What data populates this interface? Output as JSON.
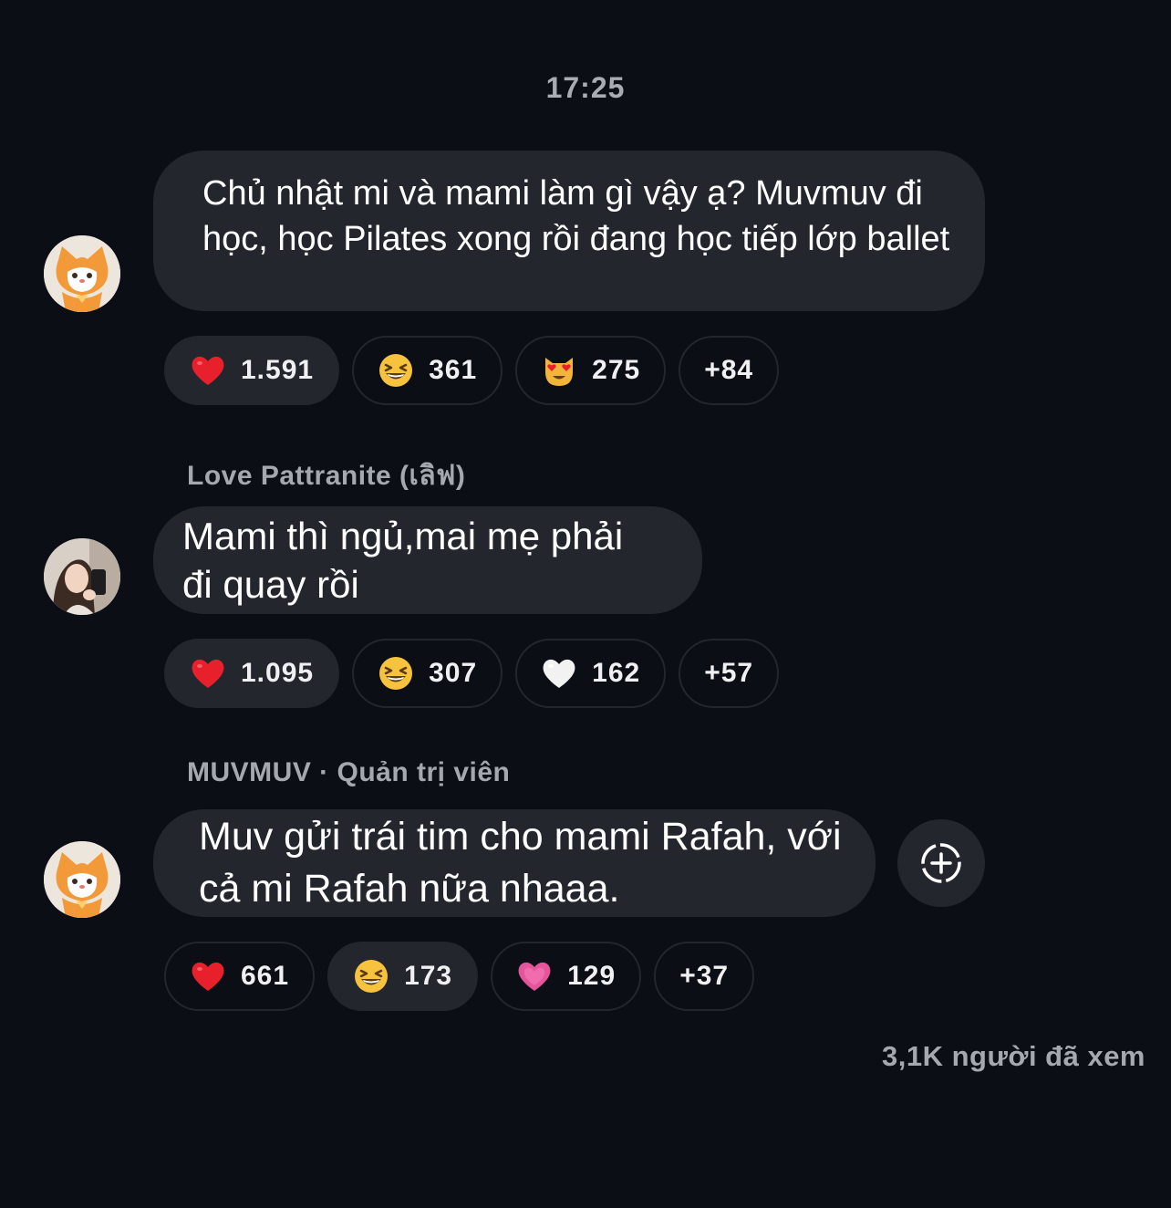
{
  "timestamp": "17:25",
  "messages": [
    {
      "sender": "",
      "avatar_icon": "orange-cat-avatar-icon",
      "text": "Chủ nhật mi và mami làm gì vậy ạ? Muvmuv đi học, học Pilates xong rồi đang học tiếp lớp ballet",
      "reactions": [
        {
          "emoji": "red-heart-icon",
          "count": "1.591",
          "active": true
        },
        {
          "emoji": "grinning-squinting-face-icon",
          "count": "361",
          "active": false
        },
        {
          "emoji": "heart-eyes-cat-icon",
          "count": "275",
          "active": false
        },
        {
          "emoji": "",
          "count": "+84",
          "active": false
        }
      ]
    },
    {
      "sender": "Love Pattranite (เลิฟ)",
      "avatar_icon": "user-photo-avatar",
      "text": "Mami thì ngủ,mai mẹ phải đi quay rồi",
      "reactions": [
        {
          "emoji": "red-heart-icon",
          "count": "1.095",
          "active": true
        },
        {
          "emoji": "grinning-squinting-face-icon",
          "count": "307",
          "active": false
        },
        {
          "emoji": "white-heart-icon",
          "count": "162",
          "active": false
        },
        {
          "emoji": "",
          "count": "+57",
          "active": false
        }
      ]
    },
    {
      "sender": "MUVMUV · Quản trị viên",
      "avatar_icon": "orange-cat-avatar-icon",
      "text": "Muv gửi trái tim cho mami Rafah, với cả mi Rafah nữa nhaaa.",
      "reactions": [
        {
          "emoji": "red-heart-icon",
          "count": "661",
          "active": false
        },
        {
          "emoji": "grinning-squinting-face-icon",
          "count": "173",
          "active": true
        },
        {
          "emoji": "pink-heart-icon",
          "count": "129",
          "active": false
        },
        {
          "emoji": "",
          "count": "+37",
          "active": false
        }
      ]
    }
  ],
  "add_reaction_icon": "add-reaction-icon",
  "views_text": "3,1K người đã xem",
  "colors": {
    "background": "#0b0e15",
    "bubble": "#23262d",
    "muted_text": "#a5a8ae"
  }
}
